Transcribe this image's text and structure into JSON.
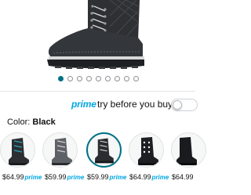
{
  "gallery": {
    "dot_count": 9,
    "active_index": 0
  },
  "prime_try": {
    "brand": "prime",
    "text": "try before you buy",
    "toggle_on": false
  },
  "color": {
    "label": "Color:",
    "selected": "Black"
  },
  "variants": [
    {
      "name": "variant-1",
      "price": "$64.99",
      "badge": "prime",
      "selected": false
    },
    {
      "name": "variant-2",
      "price": "$59.99",
      "badge": "prime",
      "selected": false
    },
    {
      "name": "variant-3",
      "price": "$59.99",
      "badge": "prime",
      "selected": true
    },
    {
      "name": "variant-4",
      "price": "$64.99",
      "badge": "prime",
      "selected": false
    },
    {
      "name": "variant-5",
      "price": "$64.99",
      "badge": "",
      "selected": false
    }
  ],
  "colors": {
    "accent": "#007185",
    "prime_blue": "#00a8e1",
    "boot_dark": "#2b2d30"
  }
}
